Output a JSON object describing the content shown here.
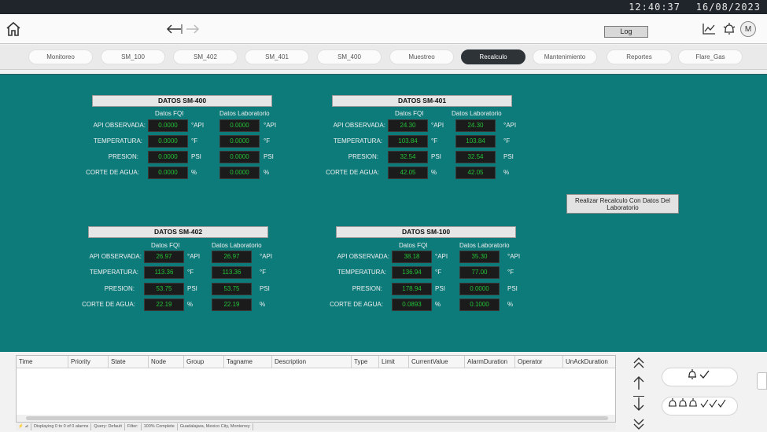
{
  "header": {
    "time": "12:40:37",
    "date": "16/08/2023"
  },
  "toolbar": {
    "log_label": "Log",
    "avatar_initial": "M"
  },
  "tabs": [
    {
      "label": "Monitoreo"
    },
    {
      "label": "SM_100"
    },
    {
      "label": "SM_402"
    },
    {
      "label": "SM_401"
    },
    {
      "label": "SM_400"
    },
    {
      "label": "Muestreo"
    },
    {
      "label": "Recalculo",
      "active": true
    },
    {
      "label": "Mantenimiento"
    },
    {
      "label": "Reportes"
    },
    {
      "label": "Flare_Gas"
    }
  ],
  "labels": {
    "fqi": "Datos FQI",
    "lab": "Datos Laboratorio",
    "api": "API OBSERVADA:",
    "temp": "TEMPERATURA:",
    "pres": "PRESION:",
    "corte": "CORTE DE AGUA:",
    "u_api": "°API",
    "u_temp": "°F",
    "u_psi": "PSI",
    "u_pct": "%"
  },
  "panels": {
    "sm400": {
      "title": "DATOS SM-400",
      "fqi": [
        "0.0000",
        "0.0000",
        "0.0000",
        "0.0000"
      ],
      "lab": [
        "0.0000",
        "0.0000",
        "0.0000",
        "0.0000"
      ]
    },
    "sm401": {
      "title": "DATOS SM-401",
      "fqi": [
        "24.30",
        "103.84",
        "32.54",
        "42.05"
      ],
      "lab": [
        "24.30",
        "103.84",
        "32.54",
        "42.05"
      ]
    },
    "sm402": {
      "title": "DATOS SM-402",
      "fqi": [
        "26.97",
        "113.36",
        "53.75",
        "22.19"
      ],
      "lab": [
        "26.97",
        "113.36",
        "53.75",
        "22.19"
      ]
    },
    "sm100": {
      "title": "DATOS SM-100",
      "fqi": [
        "38.18",
        "136.94",
        "178.94",
        "0.0893"
      ],
      "lab": [
        "35.30",
        "77.00",
        "0.0000",
        "0.1000"
      ]
    }
  },
  "recalc_button": "Realizar Recalculo Con Datos Del Laboratorio",
  "alarm_table": {
    "columns": [
      "Time",
      "Priority",
      "State",
      "Node",
      "Group",
      "Tagname",
      "Description",
      "Type",
      "Limit",
      "CurrentValue",
      "AlarmDuration",
      "Operator",
      "UnAckDuration"
    ]
  },
  "status_bar": [
    "Displaying 0 to 0 of 0 alarms",
    "Query: Default",
    "Filter:",
    "100% Complete",
    "Guadalajara, Mexico City, Monterrey"
  ],
  "ack_buttons": {
    "single": "🔔✓",
    "all": "🔔🔔🔔✓✓✓"
  },
  "colors": {
    "teal": "#0e7b7b",
    "value_green": "#23c23a",
    "active_tab": "#2e3338"
  }
}
